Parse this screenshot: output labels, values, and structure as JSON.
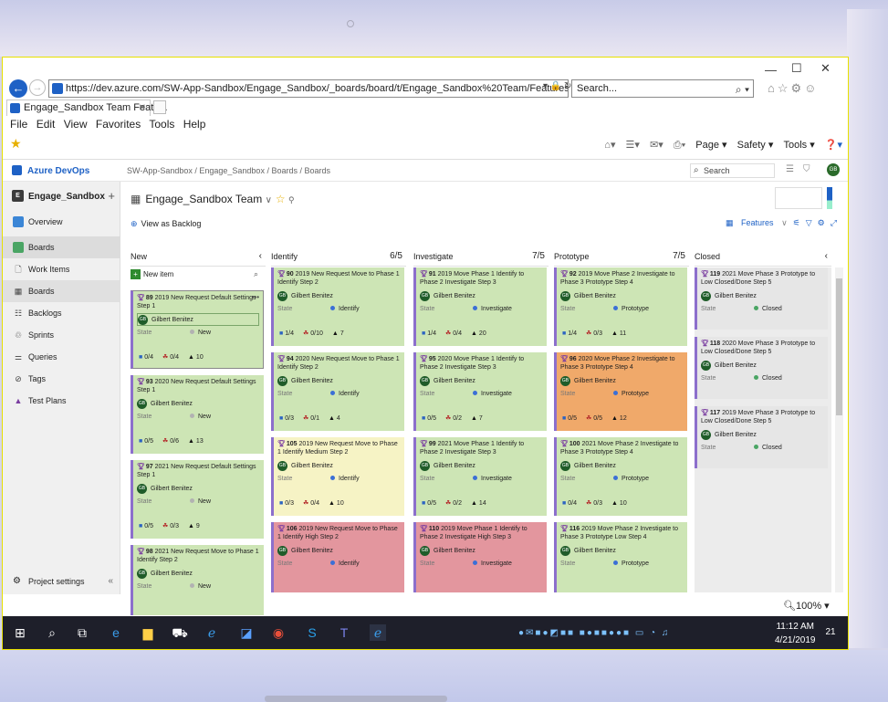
{
  "browser": {
    "url": "https://dev.azure.com/SW-App-Sandbox/Engage_Sandbox/_boards/board/t/Engage_Sandbox%20Team/Features?showParents=true",
    "search_placeholder": "Search...",
    "tab_title": "Engage_Sandbox Team Featu...",
    "menu": [
      "File",
      "Edit",
      "View",
      "Favorites",
      "Tools",
      "Help"
    ],
    "command_items": [
      "Page ▾",
      "Safety ▾",
      "Tools ▾"
    ],
    "zoom": "100%"
  },
  "ado": {
    "logo": "Azure DevOps",
    "breadcrumbs": "SW-App-Sandbox  /  Engage_Sandbox  /  Boards  /  Boards",
    "search_placeholder": "Search",
    "avatar_initials": "GB"
  },
  "sidebar": {
    "project": "Engage_Sandbox",
    "project_initial": "E",
    "items": [
      {
        "label": "Overview"
      },
      {
        "label": "Boards"
      },
      {
        "label": "Work Items"
      },
      {
        "label": "Boards"
      },
      {
        "label": "Backlogs"
      },
      {
        "label": "Sprints"
      },
      {
        "label": "Queries"
      },
      {
        "label": "Tags"
      },
      {
        "label": "Test Plans"
      }
    ],
    "project_settings": "Project settings"
  },
  "board": {
    "title": "Engage_Sandbox Team",
    "view_as_backlog": "View as Backlog",
    "level": "Features",
    "new_item": "New item",
    "columns": [
      {
        "name": "New",
        "count": ""
      },
      {
        "name": "Identify",
        "count": "6/5"
      },
      {
        "name": "Investigate",
        "count": "7/5"
      },
      {
        "name": "Prototype",
        "count": "7/5"
      },
      {
        "name": "Closed",
        "count": ""
      }
    ]
  },
  "cards": {
    "new": [
      {
        "id": "89",
        "title": "2019 New Request Default Settings Step 1",
        "user": "Gilbert Benitez",
        "state": "New",
        "m1": "0/4",
        "m2": "0/4",
        "m3": "10"
      },
      {
        "id": "93",
        "title": "2020 New Request Default Settings Step 1",
        "user": "Gilbert Benitez",
        "state": "New",
        "m1": "0/5",
        "m2": "0/6",
        "m3": "13"
      },
      {
        "id": "97",
        "title": "2021 New Request Default Settings Step 1",
        "user": "Gilbert Benitez",
        "state": "New",
        "m1": "0/5",
        "m2": "0/3",
        "m3": "9"
      },
      {
        "id": "98",
        "title": "2021 New Request Move to Phase 1 Identify Step 2",
        "user": "Gilbert Benitez",
        "state": "New",
        "m1": "",
        "m2": "",
        "m3": ""
      }
    ],
    "identify": [
      {
        "id": "90",
        "title": "2019 New Request Move to Phase 1 Identify Step 2",
        "user": "Gilbert Benitez",
        "state": "Identify",
        "m1": "1/4",
        "m2": "0/10",
        "m3": "7"
      },
      {
        "id": "94",
        "title": "2020 New Request Move to Phase 1 Identify Step 2",
        "user": "Gilbert Benitez",
        "state": "Identify",
        "m1": "0/3",
        "m2": "0/1",
        "m3": "4"
      },
      {
        "id": "105",
        "title": "2019 New Request Move to Phase 1 Identify Medium Step 2",
        "user": "Gilbert Benitez",
        "state": "Identify",
        "m1": "0/3",
        "m2": "0/4",
        "m3": "10"
      },
      {
        "id": "106",
        "title": "2019 New Request Move to Phase 1 Identify High Step 2",
        "user": "Gilbert Benitez",
        "state": "Identify",
        "m1": "",
        "m2": "",
        "m3": ""
      }
    ],
    "investigate": [
      {
        "id": "91",
        "title": "2019 Move Phase 1 Identify to Phase 2 Investigate Step 3",
        "user": "Gilbert Benitez",
        "state": "Investigate",
        "m1": "1/4",
        "m2": "0/4",
        "m3": "20"
      },
      {
        "id": "95",
        "title": "2020 Move Phase 1 Identify to Phase 2 Investigate Step 3",
        "user": "Gilbert Benitez",
        "state": "Investigate",
        "m1": "0/5",
        "m2": "0/2",
        "m3": "7"
      },
      {
        "id": "99",
        "title": "2021 Move Phase 1 Identify to Phase 2 Investigate Step 3",
        "user": "Gilbert Benitez",
        "state": "Investigate",
        "m1": "0/5",
        "m2": "0/2",
        "m3": "14"
      },
      {
        "id": "110",
        "title": "2019 Move Phase 1 Identify to Phase 2 Investigate High Step 3",
        "user": "Gilbert Benitez",
        "state": "Investigate",
        "m1": "",
        "m2": "",
        "m3": ""
      }
    ],
    "prototype": [
      {
        "id": "92",
        "title": "2019 Move Phase 2 Investigate to Phase 3 Prototype Step 4",
        "user": "Gilbert Benitez",
        "state": "Prototype",
        "m1": "1/4",
        "m2": "0/3",
        "m3": "11"
      },
      {
        "id": "96",
        "title": "2020 Move Phase 2 Investigate to Phase 3 Prototype Step 4",
        "user": "Gilbert Benitez",
        "state": "Prototype",
        "m1": "0/5",
        "m2": "0/5",
        "m3": "12"
      },
      {
        "id": "100",
        "title": "2021 Move Phase 2 Investigate to Phase 3 Prototype Step 4",
        "user": "Gilbert Benitez",
        "state": "Prototype",
        "m1": "0/4",
        "m2": "0/3",
        "m3": "10"
      },
      {
        "id": "116",
        "title": "2019 Move Phase 2 Investigate to Phase 3 Prototype Low Step 4",
        "user": "Gilbert Benitez",
        "state": "Prototype",
        "m1": "",
        "m2": "",
        "m3": ""
      }
    ],
    "closed": [
      {
        "id": "119",
        "title": "2021 Move Phase 3 Prototype to Low Closed/Done Step 5",
        "user": "Gilbert Benitez",
        "state": "Closed"
      },
      {
        "id": "118",
        "title": "2020 Move Phase 3 Prototype to Low Closed/Done Step 5",
        "user": "Gilbert Benitez",
        "state": "Closed"
      },
      {
        "id": "117",
        "title": "2019 Move Phase 3 Prototype to Low Closed/Done Step 5",
        "user": "Gilbert Benitez",
        "state": "Closed"
      }
    ],
    "state_label": "State"
  },
  "taskbar": {
    "time": "11:12 AM",
    "date": "4/21/2019",
    "notifications": "21"
  },
  "colors": {
    "card_green": "#cde5b5",
    "card_yellow": "#f6f3c5",
    "card_orange": "#f0a96a",
    "card_red": "#e3969e",
    "accent_blue": "#1e61c5"
  }
}
